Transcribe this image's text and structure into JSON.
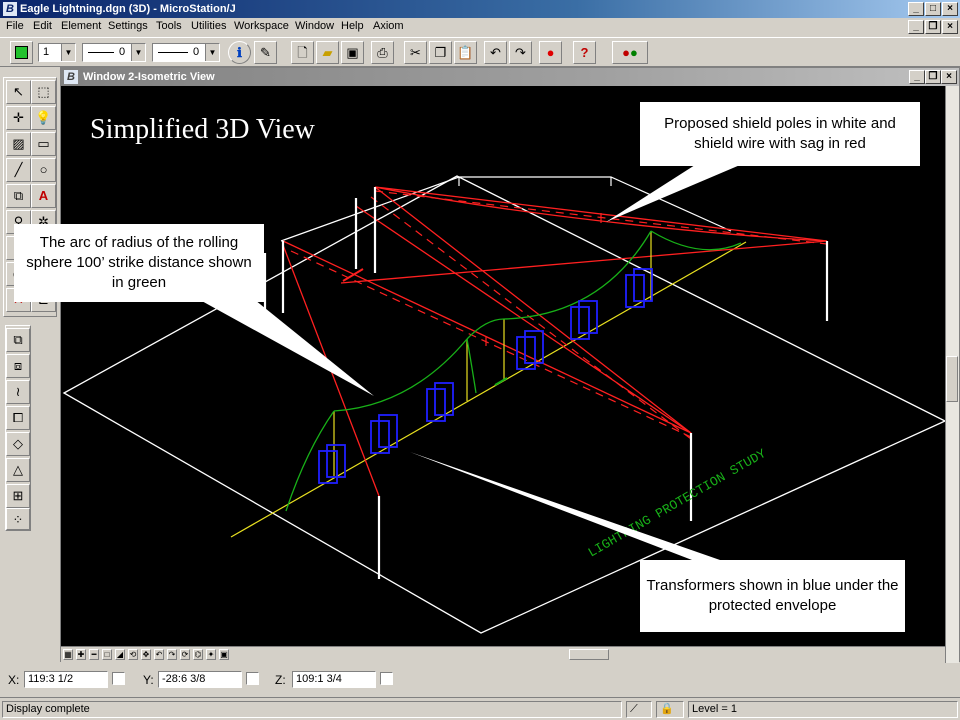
{
  "app": {
    "title": "Eagle Lightning.dgn (3D) - MicroStation/J",
    "icon": "microstation-logo-icon"
  },
  "menu": [
    "File",
    "Edit",
    "Element",
    "Settings",
    "Tools",
    "Utilities",
    "Workspace",
    "Window",
    "Help",
    "Axiom"
  ],
  "toolbar": {
    "color_swatch": "#22c22e",
    "level": "1",
    "line_style": "0",
    "line_weight": "0"
  },
  "view_window": {
    "title": "Window 2-Isometric View"
  },
  "annotations": {
    "heading": "Simplified 3D View",
    "shield": "Proposed shield poles in white and shield wire with sag in red",
    "arc": "The arc of radius of the rolling sphere 100’ strike distance shown in green",
    "transformers": "Transformers shown in blue under the protected envelope",
    "model_text": "LIGHTNING PROTECTION STUDY"
  },
  "colors": {
    "shield_wire": "#ff2020",
    "poles": "#ffffff",
    "arc": "#18b018",
    "transformers": "#2020ff",
    "centerline": "#e8e020"
  },
  "coordinates": {
    "x_label": "X:",
    "x_value": "119:3  1/2",
    "y_label": "Y:",
    "y_value": "-28:6  3/8",
    "z_label": "Z:",
    "z_value": "109:1  3/4"
  },
  "status": {
    "message": "Display complete",
    "level": "Level = 1"
  }
}
